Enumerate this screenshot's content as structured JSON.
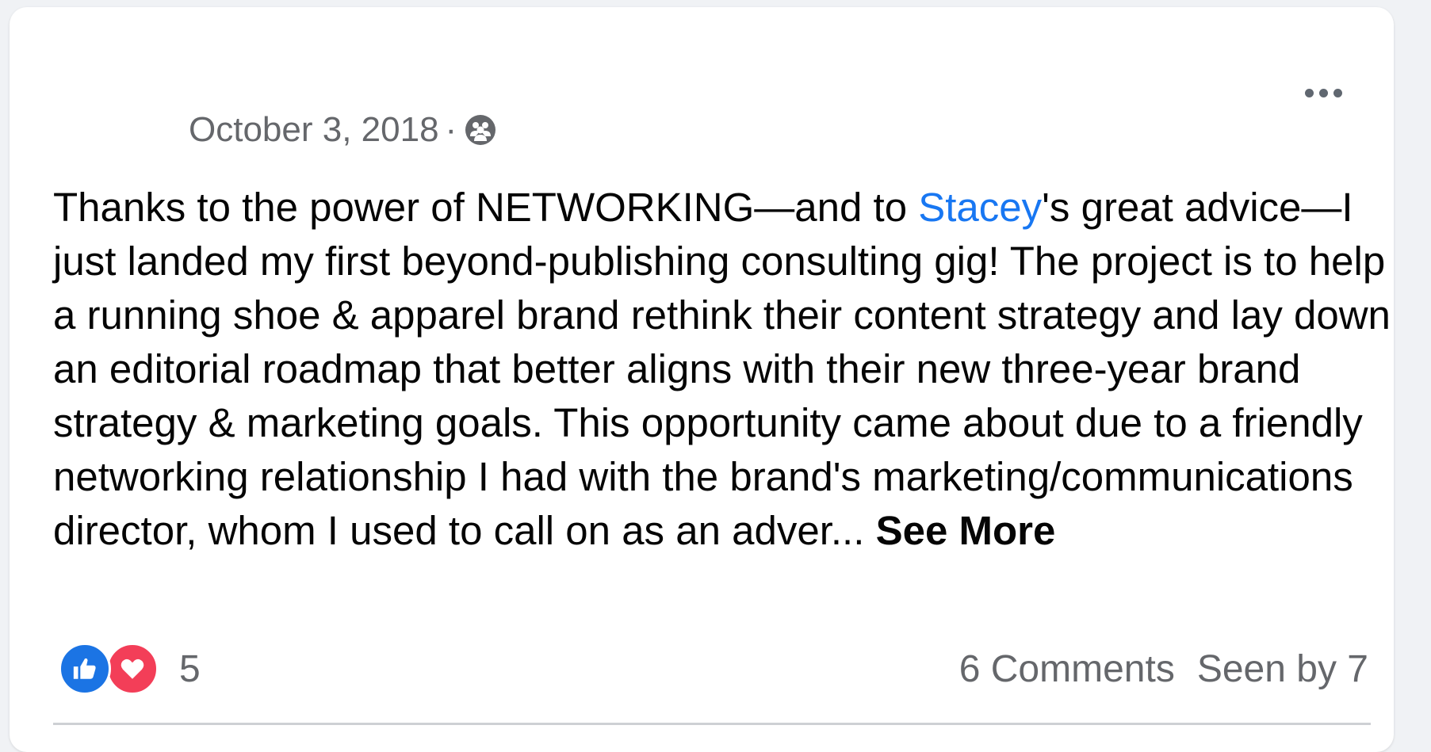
{
  "post": {
    "date": "October 3, 2018",
    "separator": "·",
    "audience_icon": "group-audience-icon",
    "text": {
      "part1": "Thanks to the power of NETWORKING—and to ",
      "mention": "Stacey",
      "part2": "'s great advice—I just landed my first beyond-publishing consulting gig! The project is to help a running shoe & apparel brand rethink their content strategy and lay down an editorial roadmap that better aligns with their new three-year brand strategy & marketing goals. This opportunity came about due to a friendly networking relationship I had with the brand's marketing/communications director, whom I used to call on as an adver... ",
      "see_more": "See More"
    },
    "more_menu_icon": "more-options-icon"
  },
  "footer": {
    "reactions": [
      {
        "type": "like",
        "icon": "thumbs-up-icon",
        "color": "#1b74e4"
      },
      {
        "type": "love",
        "icon": "heart-icon",
        "color": "#f33e58"
      }
    ],
    "reaction_count": "5",
    "comments": "6 Comments",
    "seen_by": "Seen by 7"
  },
  "colors": {
    "link": "#1877f2",
    "muted": "#65676b",
    "text": "#050505"
  }
}
